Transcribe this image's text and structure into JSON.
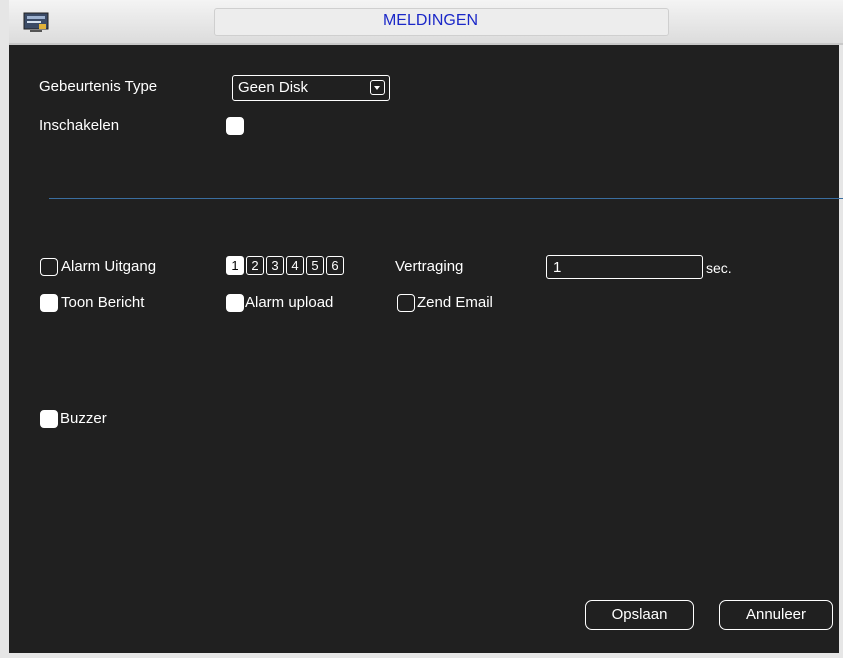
{
  "window": {
    "title": "MELDINGEN",
    "icon": "monitor-menu-icon"
  },
  "form": {
    "event_type_label": "Gebeurtenis Type",
    "event_type_value": "Geen Disk",
    "enable_label": "Inschakelen",
    "enable_checked": false
  },
  "alarm": {
    "alarm_output_label": "Alarm Uitgang",
    "alarm_output_checked": false,
    "channels": [
      "1",
      "2",
      "3",
      "4",
      "5",
      "6"
    ],
    "selected_channel": "1",
    "delay_label": "Vertraging",
    "delay_value": "1",
    "delay_unit": "sec.",
    "show_message_label": "Toon Bericht",
    "show_message_checked": true,
    "alarm_upload_label": "Alarm upload",
    "alarm_upload_checked": true,
    "send_email_label": "Zend Email",
    "send_email_checked": false,
    "buzzer_label": "Buzzer",
    "buzzer_checked": true
  },
  "actions": {
    "save_label": "Opslaan",
    "cancel_label": "Annuleer"
  },
  "colors": {
    "background": "#202020",
    "title_text": "#1b28c8",
    "divider": "#3a6ea0"
  }
}
